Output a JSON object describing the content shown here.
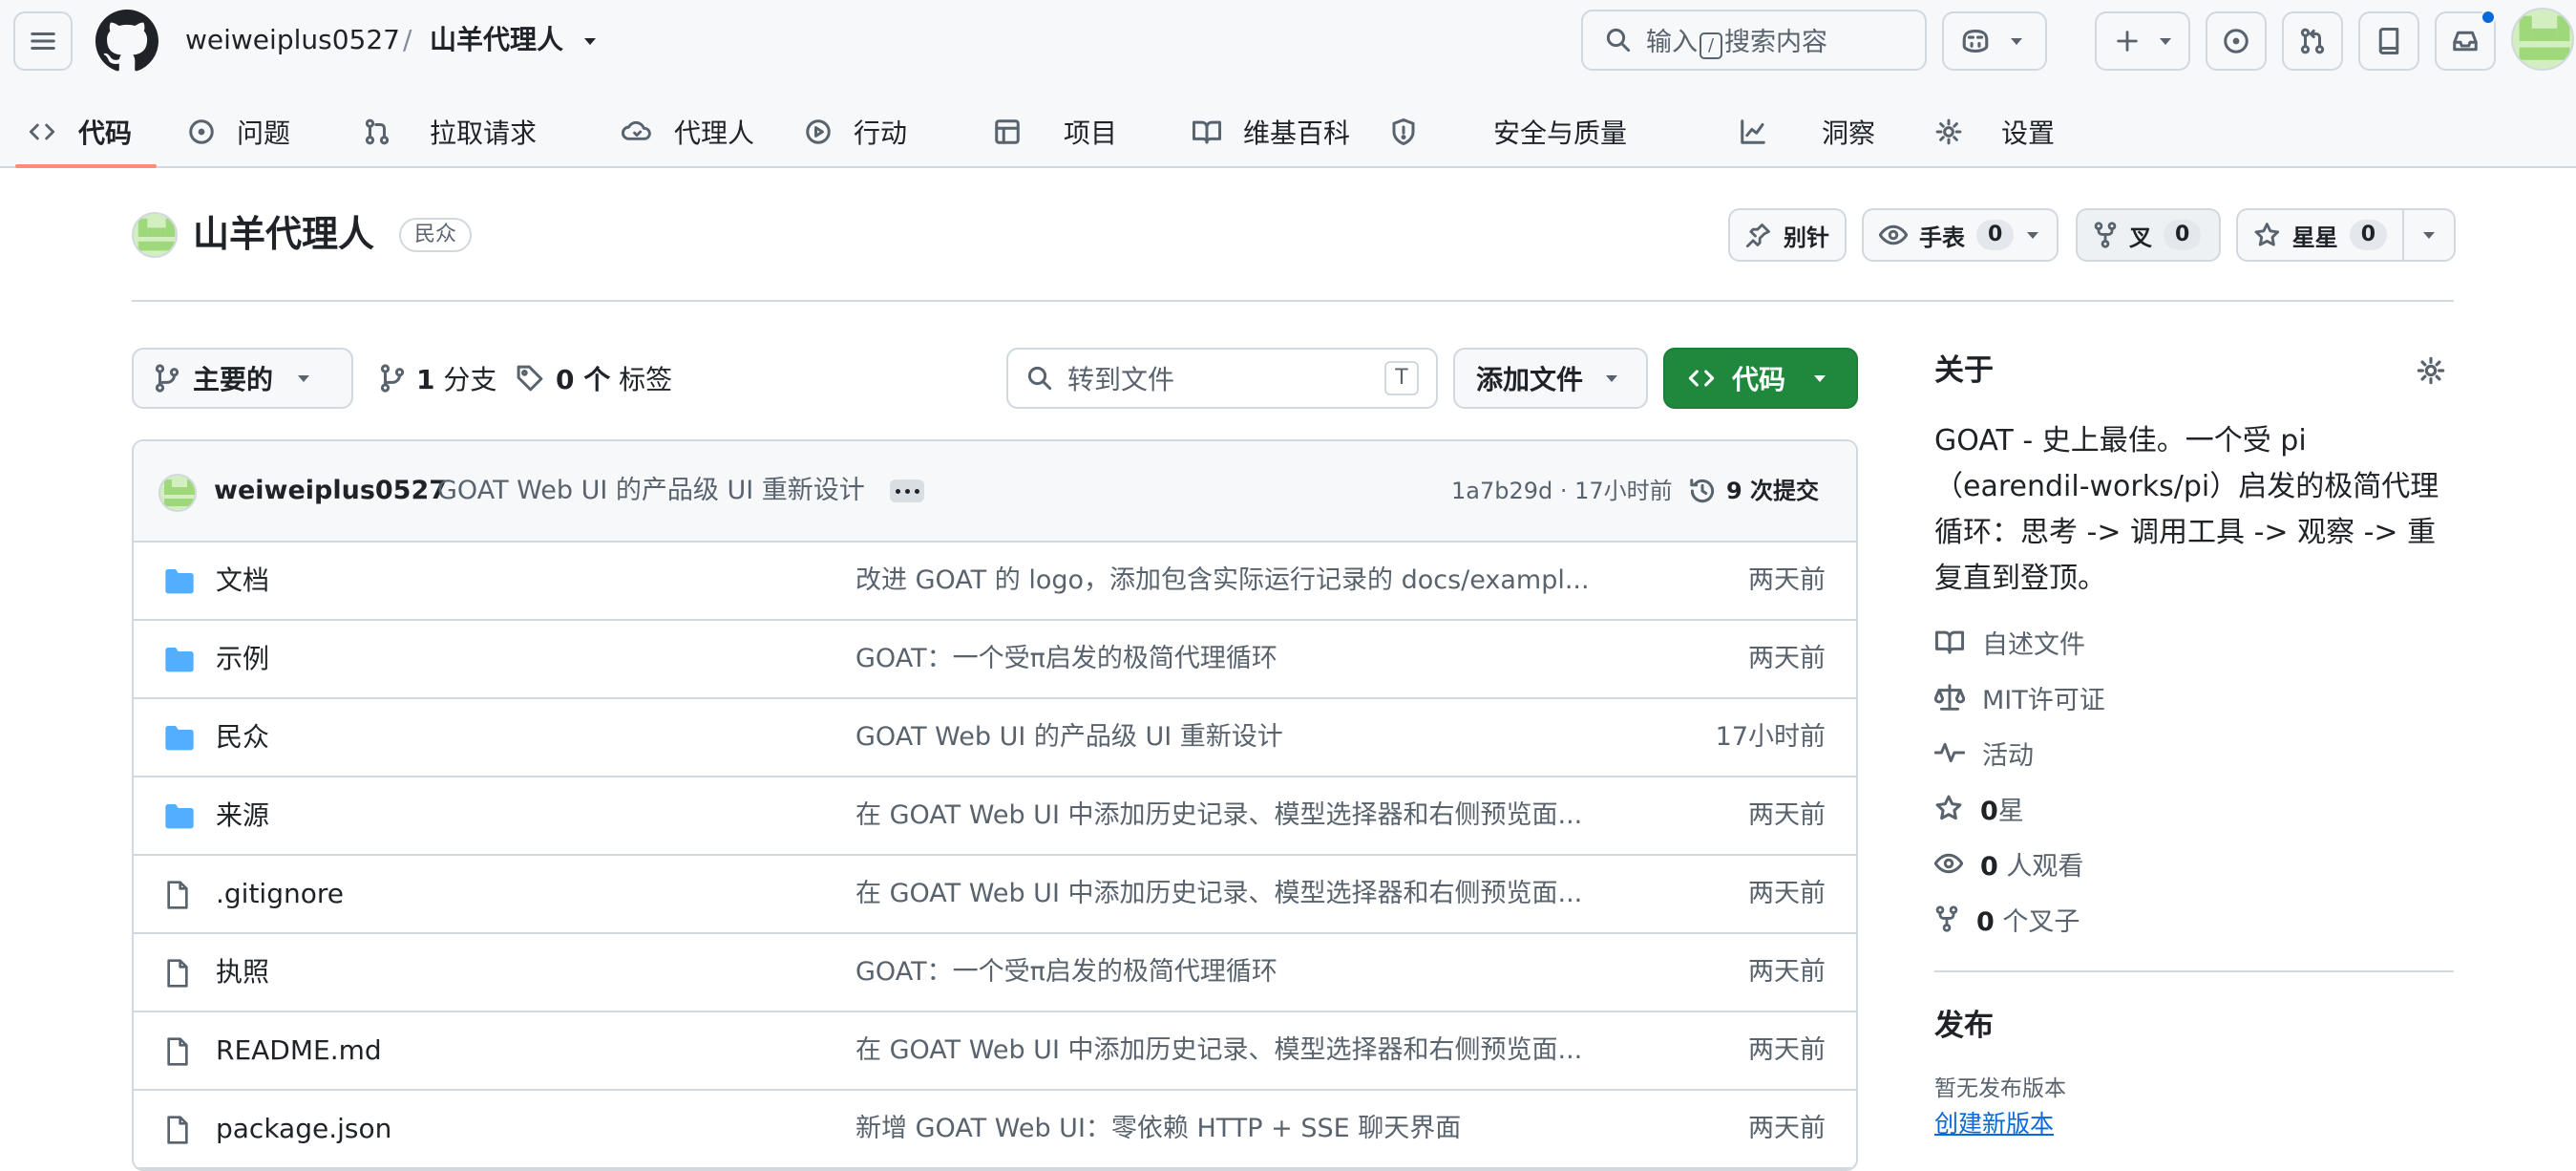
{
  "header": {
    "owner": "weiweiplus0527",
    "separator": "/",
    "repo": "山羊代理人",
    "search_placeholder_pre": "输入",
    "search_key": "/",
    "search_placeholder_post": "搜索内容"
  },
  "tabs": [
    {
      "label": "代码",
      "icon": "code-icon"
    },
    {
      "label": "问题",
      "icon": "issue-icon"
    },
    {
      "label": "拉取请求",
      "icon": "pull-request-icon"
    },
    {
      "label": "代理人",
      "icon": "agent-icon"
    },
    {
      "label": "行动",
      "icon": "actions-icon"
    },
    {
      "label": "项目",
      "icon": "table-icon"
    },
    {
      "label": "维基百科",
      "icon": "book-icon"
    },
    {
      "label": "安全与质量",
      "icon": "shield-icon"
    },
    {
      "label": "洞察",
      "icon": "graph-icon"
    },
    {
      "label": "设置",
      "icon": "gear-icon"
    }
  ],
  "repo": {
    "title": "山羊代理人",
    "visibility": "民众",
    "pin_label": "别针",
    "watch_label": "手表",
    "watch_count": "0",
    "fork_label": "叉",
    "fork_count": "0",
    "star_label": "星星",
    "star_count": "0"
  },
  "toolbar": {
    "branch": "主要的",
    "branches_count": "1",
    "branches_label": "分支",
    "tags_count": "0 个",
    "tags_label": "标签",
    "goto_placeholder": "转到文件",
    "goto_key": "T",
    "add_file": "添加文件",
    "code": "代码"
  },
  "commit": {
    "author": "weiweiplus0527",
    "message": "GOAT Web UI 的产品级 UI 重新设计",
    "hash_time": "1a7b29d · 17小时前",
    "count_label": "9 次提交"
  },
  "files": [
    {
      "type": "folder",
      "name": "文档",
      "message": "改进 GOAT 的 logo，添加包含实际运行记录的 docs/exampl...",
      "date": "两天前"
    },
    {
      "type": "folder",
      "name": "示例",
      "message": "GOAT：一个受π启发的极简代理循环",
      "date": "两天前"
    },
    {
      "type": "folder",
      "name": "民众",
      "message": "GOAT Web UI 的产品级 UI 重新设计",
      "date": "17小时前"
    },
    {
      "type": "folder",
      "name": "来源",
      "message": "在 GOAT Web UI 中添加历史记录、模型选择器和右侧预览面...",
      "date": "两天前"
    },
    {
      "type": "file",
      "name": ".gitignore",
      "message": "在 GOAT Web UI 中添加历史记录、模型选择器和右侧预览面...",
      "date": "两天前"
    },
    {
      "type": "file",
      "name": "执照",
      "message": "GOAT：一个受π启发的极简代理循环",
      "date": "两天前"
    },
    {
      "type": "file",
      "name": "README.md",
      "message": "在 GOAT Web UI 中添加历史记录、模型选择器和右侧预览面...",
      "date": "两天前"
    },
    {
      "type": "file",
      "name": "package.json",
      "message": "新增 GOAT Web UI：零依赖 HTTP + SSE 聊天界面",
      "date": "两天前"
    }
  ],
  "about": {
    "heading": "关于",
    "description": "GOAT - 史上最佳。一个受 pi（earendil-works/pi）启发的极简代理循环：思考 -> 调用工具 -> 观察 -> 重复直到登顶。",
    "readme": "自述文件",
    "license": "MIT许可证",
    "activity": "活动",
    "stars_count": "0",
    "stars_label": "星",
    "watchers_count": "0",
    "watchers_label": "人观看",
    "forks_count": "0",
    "forks_label": "个叉子"
  },
  "releases": {
    "heading": "发布",
    "none": "暂无发布版本",
    "create": "创建新版本"
  },
  "colors": {
    "primary_button": "#1f883d",
    "tab_underline": "#fd8c73",
    "folder": "#54aeff",
    "link": "#0969da",
    "notification": "#0969da"
  }
}
